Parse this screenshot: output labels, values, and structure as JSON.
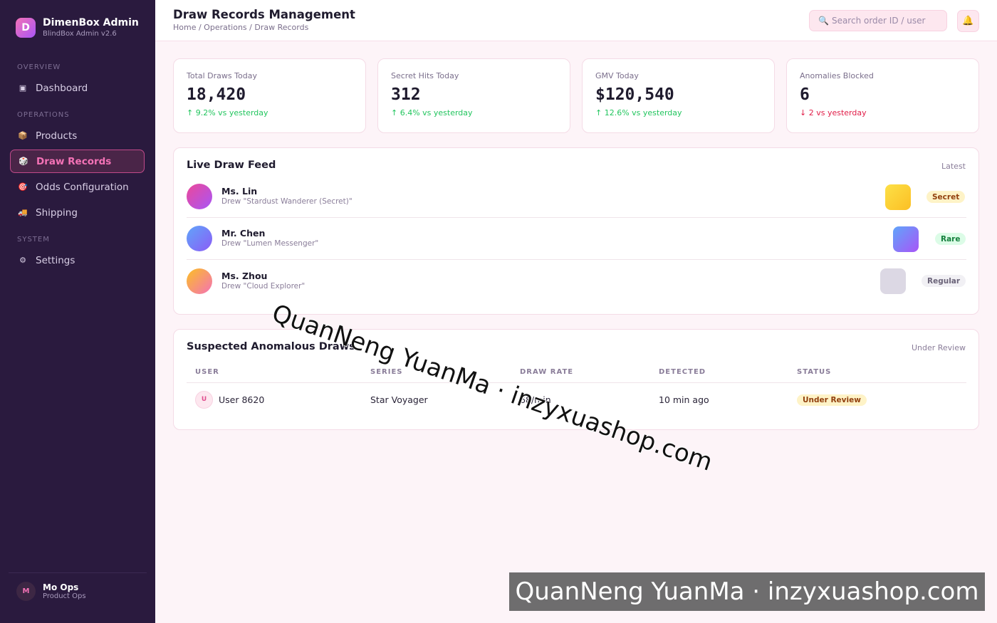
{
  "sidebar": {
    "brand": {
      "initial": "D",
      "name": "DimenBox Admin",
      "subtitle": "BlindBox Admin v2.6"
    },
    "sections": {
      "overview": "OVERVIEW",
      "operations": "OPERATIONS",
      "system": "SYSTEM"
    },
    "items": [
      {
        "label": "Dashboard",
        "icon": "▣",
        "icon_name": "dashboard-icon"
      },
      {
        "label": "Products",
        "icon": "📦",
        "icon_name": "package-icon"
      },
      {
        "label": "Draw Records",
        "icon": "🎲",
        "icon_name": "dice-icon",
        "active": true
      },
      {
        "label": "Odds Configuration",
        "icon": "🎯",
        "icon_name": "target-icon"
      },
      {
        "label": "Shipping",
        "icon": "🚚",
        "icon_name": "truck-icon"
      },
      {
        "label": "Settings",
        "icon": "⚙",
        "icon_name": "gear-icon"
      }
    ],
    "user": {
      "initial": "M",
      "name": "Mo Ops",
      "role": "Product Ops"
    }
  },
  "header": {
    "title": "Draw Records Management",
    "breadcrumb": "Home / Operations / Draw Records",
    "search_placeholder": "Search order ID / user",
    "search_icon": "🔍",
    "bell_icon": "🔔"
  },
  "stats": [
    {
      "label": "Total Draws Today",
      "value": "18,420",
      "delta": "↑ 9.2% vs yesterday",
      "trend": "up"
    },
    {
      "label": "Secret Hits Today",
      "value": "312",
      "delta": "↑ 6.4% vs yesterday",
      "trend": "up"
    },
    {
      "label": "GMV Today",
      "value": "$120,540",
      "delta": "↑ 12.6% vs yesterday",
      "trend": "up"
    },
    {
      "label": "Anomalies Blocked",
      "value": "6",
      "delta": "↓ 2 vs yesterday",
      "trend": "down"
    }
  ],
  "feed": {
    "title": "Live Draw Feed",
    "aside": "Latest",
    "rows": [
      {
        "name": "Ms. Lin",
        "desc": "Drew \"Stardust Wanderer (Secret)\"",
        "tag": "Secret",
        "tag_bg": "#fef3c7",
        "tag_color": "#92400e"
      },
      {
        "name": "Mr. Chen",
        "desc": "Drew \"Lumen Messenger\"",
        "tag": "Rare",
        "tag_bg": "#dcfce7",
        "tag_color": "#15803d"
      },
      {
        "name": "Ms. Zhou",
        "desc": "Drew \"Cloud Explorer\"",
        "tag": "Regular",
        "tag_bg": "#f1f0f4",
        "tag_color": "#6b6479"
      }
    ]
  },
  "anomalies": {
    "title": "Suspected Anomalous Draws",
    "aside": "Under Review",
    "columns": [
      "USER",
      "SERIES",
      "DRAW RATE",
      "DETECTED",
      "STATUS"
    ],
    "rows": [
      {
        "initial": "U",
        "user": "User 8620",
        "series": "Star Voyager",
        "rate": "68/min",
        "detected": "10 min ago",
        "status": "Under Review"
      }
    ]
  },
  "watermark": {
    "text": "QuanNeng YuanMa · inzyxuashop.com"
  },
  "colors": {
    "accent": "#f472b6",
    "sidebar_bg": "#2a1a3e",
    "page_bg": "#fdf4f8"
  }
}
